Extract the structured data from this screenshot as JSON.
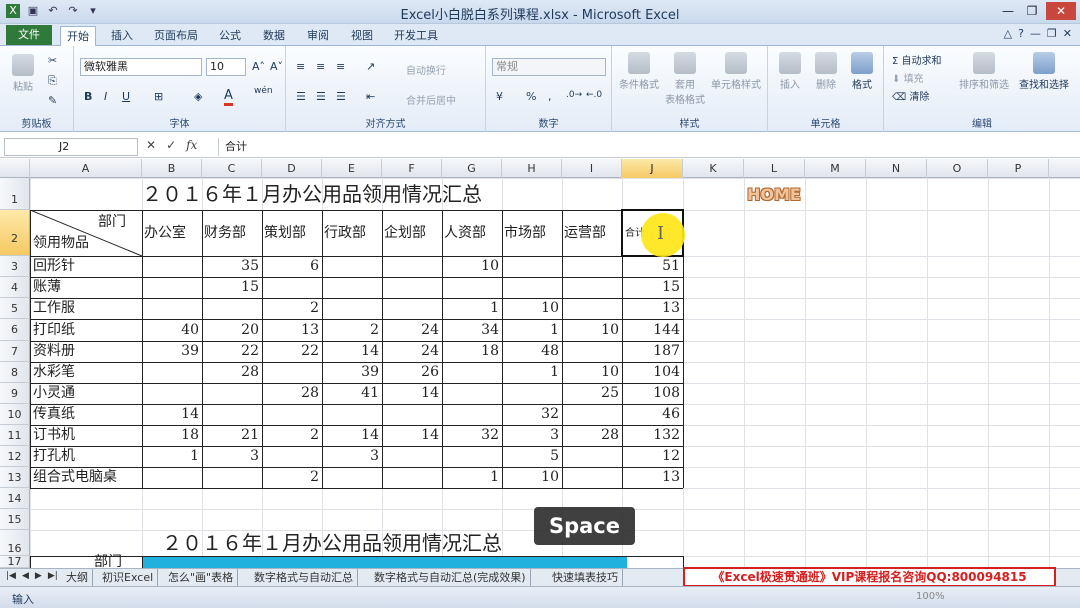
{
  "window": {
    "title": "Excel小白脱白系列课程.xlsx - Microsoft Excel",
    "quick_access_icons": [
      "excel-icon",
      "save-icon",
      "undo-icon",
      "redo-icon",
      "qat-more-icon"
    ]
  },
  "tabs": {
    "file": "文件",
    "items": [
      "开始",
      "插入",
      "页面布局",
      "公式",
      "数据",
      "审阅",
      "视图",
      "开发工具"
    ],
    "active": "开始"
  },
  "ribbon": {
    "clipboard": {
      "label": "剪贴板",
      "paste": "粘贴"
    },
    "font": {
      "label": "字体",
      "name": "微软雅黑",
      "size": "10",
      "bold": "B",
      "italic": "I",
      "underline": "U",
      "color_letter": "A",
      "pinyin": "wén"
    },
    "align": {
      "label": "对齐方式",
      "wrap": "自动换行",
      "merge": "合并后居中"
    },
    "number": {
      "label": "数字",
      "format": "常规",
      "percent": "%",
      "comma": ","
    },
    "styles": {
      "label": "样式",
      "conditional": "条件格式",
      "table_format": "套用\n表格格式",
      "cell_styles": "单元格样式"
    },
    "cells": {
      "label": "单元格",
      "insert": "插入",
      "delete": "删除",
      "format": "格式"
    },
    "editing": {
      "label": "编辑",
      "autosum": "自动求和",
      "fill": "填充",
      "clear": "清除",
      "sort": "排序和筛选",
      "find": "查找和选择"
    }
  },
  "formula_bar": {
    "name_box": "J2",
    "content": "合计"
  },
  "grid": {
    "columns": [
      "A",
      "B",
      "C",
      "D",
      "E",
      "F",
      "G",
      "H",
      "I",
      "J",
      "K",
      "L",
      "M",
      "N",
      "O",
      "P"
    ],
    "rows": [
      "1",
      "2",
      "3",
      "4",
      "5",
      "6",
      "7",
      "8",
      "9",
      "10",
      "11",
      "12",
      "13",
      "14",
      "15",
      "16",
      "17"
    ],
    "selected_column": "J",
    "selected_row": "2"
  },
  "table": {
    "title": "２０１６年１月办公用品领用情况汇总",
    "diag_top": "部门",
    "diag_bottom": "领用物品",
    "headers": [
      "办公室",
      "财务部",
      "策划部",
      "行政部",
      "企划部",
      "人资部",
      "市场部",
      "运营部"
    ],
    "total_header": "合计",
    "rows": [
      {
        "item": "回形针",
        "values": [
          "",
          "35",
          "6",
          "",
          "",
          "10",
          "",
          ""
        ],
        "total": "51"
      },
      {
        "item": "账薄",
        "values": [
          "",
          "15",
          "",
          "",
          "",
          "",
          "",
          ""
        ],
        "total": "15"
      },
      {
        "item": "工作服",
        "values": [
          "",
          "",
          "2",
          "",
          "",
          "1",
          "10",
          ""
        ],
        "total": "13"
      },
      {
        "item": "打印纸",
        "values": [
          "40",
          "20",
          "13",
          "2",
          "24",
          "34",
          "1",
          "10"
        ],
        "total": "144"
      },
      {
        "item": "资料册",
        "values": [
          "39",
          "22",
          "22",
          "14",
          "24",
          "18",
          "48",
          ""
        ],
        "total": "187"
      },
      {
        "item": "水彩笔",
        "values": [
          "",
          "28",
          "",
          "39",
          "26",
          "",
          "1",
          "10"
        ],
        "total": "104"
      },
      {
        "item": "小灵通",
        "values": [
          "",
          "",
          "28",
          "41",
          "14",
          "",
          "",
          "25"
        ],
        "total": "108"
      },
      {
        "item": "传真纸",
        "values": [
          "14",
          "",
          "",
          "",
          "",
          "",
          "32",
          ""
        ],
        "total": "46"
      },
      {
        "item": "订书机",
        "values": [
          "18",
          "21",
          "2",
          "14",
          "14",
          "32",
          "3",
          "28"
        ],
        "total": "132"
      },
      {
        "item": "打孔机",
        "values": [
          "1",
          "3",
          "",
          "3",
          "",
          "",
          "5",
          ""
        ],
        "total": "12"
      },
      {
        "item": "组合式电脑桌",
        "values": [
          "",
          "",
          "2",
          "",
          "",
          "1",
          "10",
          ""
        ],
        "total": "13"
      }
    ],
    "second_title": "２０１６年１月办公用品领用情况汇总",
    "second_diag_top": "部门"
  },
  "overlays": {
    "home": "HOME",
    "space": "Space",
    "cursor_glyph": "I",
    "accent": "#ffe617"
  },
  "sheet_tabs": [
    "大纲",
    "初识Excel",
    "怎么\"画\"表格",
    "数字格式与自动汇总",
    "数字格式与自动汇总(完成效果)",
    "快速填表技巧"
  ],
  "promo": "《Excel极速贯通班》VIP课程报名咨询QQ:800094815",
  "status": {
    "mode": "输入",
    "zoom": "100%"
  }
}
